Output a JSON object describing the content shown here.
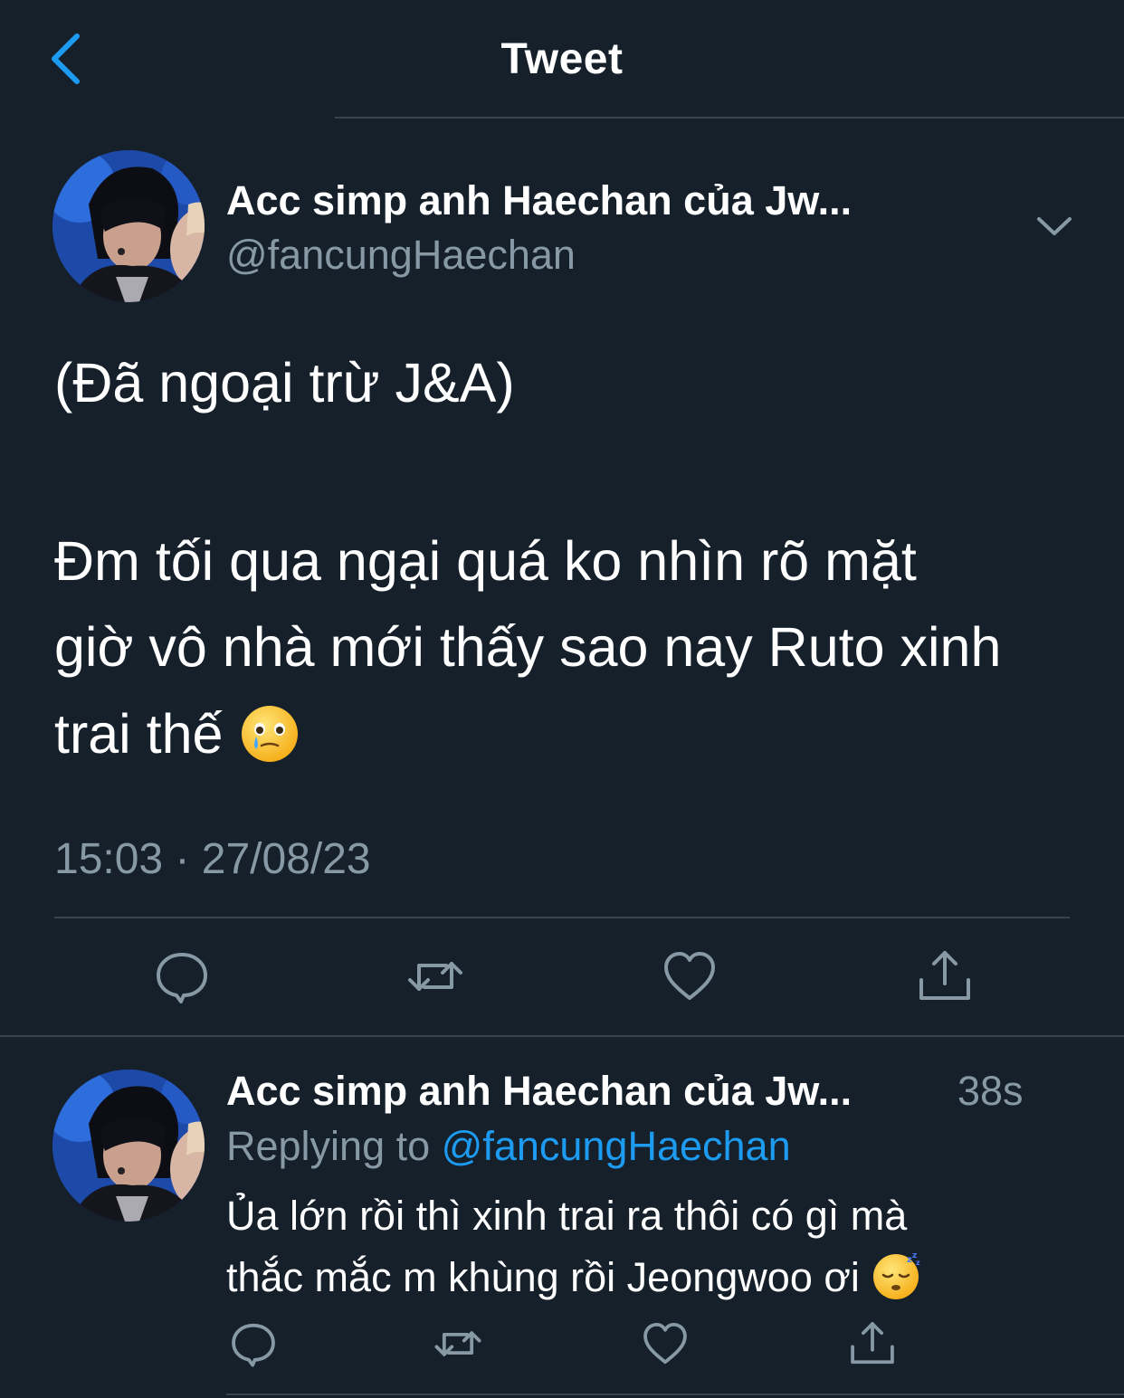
{
  "header": {
    "title": "Tweet"
  },
  "tweet": {
    "author_name": "Acc simp anh Haechan của Jw...",
    "author_handle": "@fancungHaechan",
    "lines": [
      "(Đã ngoại trừ J&A)",
      "Đm tối qua ngại quá ko nhìn rõ mặt",
      "giờ vô nhà mới thấy sao nay Ruto xinh",
      "trai thế"
    ],
    "emoji": "holding-back-tears-face",
    "timestamp": "15:03 · 27/08/23"
  },
  "reply": {
    "author_name": "Acc simp anh Haechan của Jw...",
    "time_ago": "38s",
    "replying_to_prefix": "Replying to ",
    "replying_to_handle": "@fancungHaechan",
    "lines": [
      "Ủa lớn rồi thì xinh trai ra thôi có gì mà",
      "thắc mắc m khùng rồi Jeongwoo ơi"
    ],
    "emoji": "sleeping-face"
  },
  "icons": {
    "back": "chevron-left-icon",
    "more": "chevron-down-icon",
    "reply": "reply-bubble-icon",
    "retweet": "retweet-icon",
    "like": "heart-icon",
    "share": "share-icon"
  },
  "colors": {
    "background": "#15202b",
    "accent": "#1d9bf0",
    "secondary_text": "#8899a6",
    "divider": "#38444d"
  }
}
